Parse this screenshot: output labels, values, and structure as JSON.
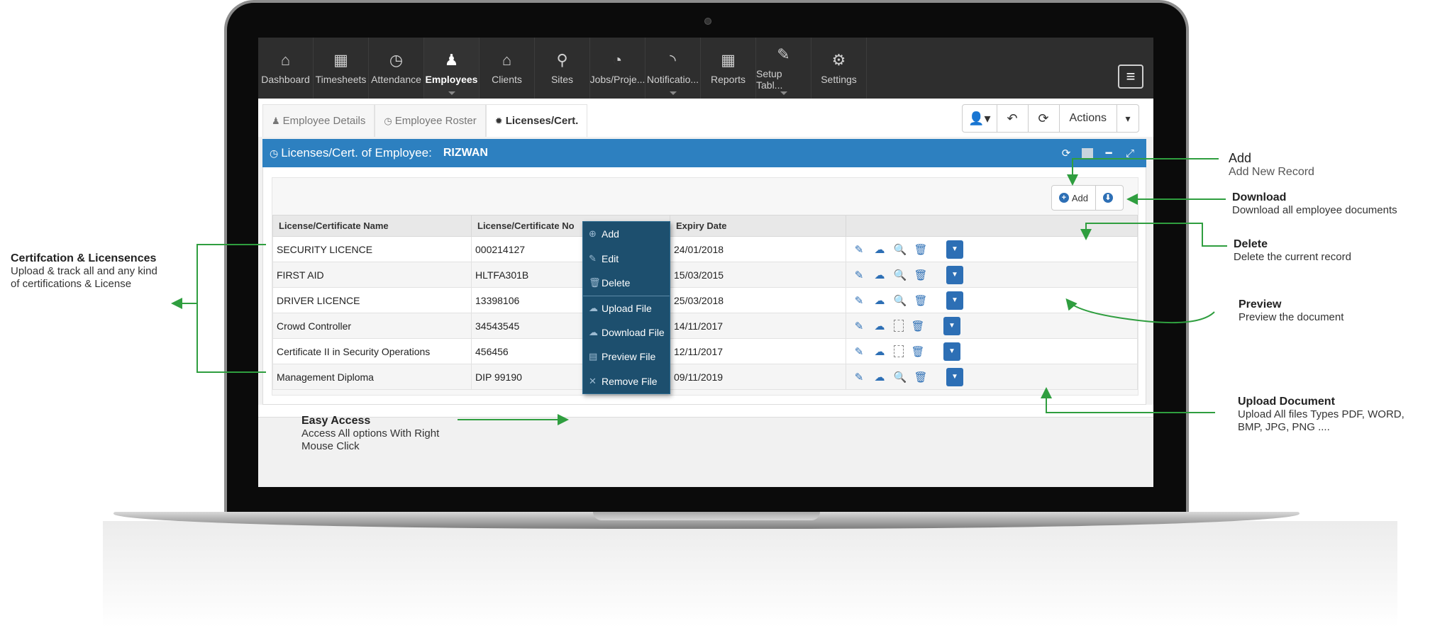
{
  "nav": {
    "items": [
      {
        "label": "Dashboard",
        "icon": "home-icon",
        "glyph": "⌂"
      },
      {
        "label": "Timesheets",
        "icon": "calendar-icon",
        "glyph": "▦"
      },
      {
        "label": "Attendance",
        "icon": "clock-icon",
        "glyph": "◷"
      },
      {
        "label": "Employees",
        "icon": "person-icon",
        "glyph": "♟"
      },
      {
        "label": "Clients",
        "icon": "bank-icon",
        "glyph": "⌂"
      },
      {
        "label": "Sites",
        "icon": "map-pin-icon",
        "glyph": "⚲"
      },
      {
        "label": "Jobs/Proje...",
        "icon": "dashboard-icon",
        "glyph": "◔"
      },
      {
        "label": "Notificatio...",
        "icon": "rss-icon",
        "glyph": "◝"
      },
      {
        "label": "Reports",
        "icon": "grid-icon",
        "glyph": "▦"
      },
      {
        "label": "Setup Tabl...",
        "icon": "edit-icon",
        "glyph": "✎"
      },
      {
        "label": "Settings",
        "icon": "gear-icon",
        "glyph": "⚙"
      }
    ],
    "menu_glyph": "≡"
  },
  "tabs": [
    {
      "label": "Employee Details",
      "glyph": "♟"
    },
    {
      "label": "Employee Roster",
      "glyph": "◷"
    },
    {
      "label": "Licenses/Cert.",
      "glyph": "✹"
    }
  ],
  "toolbar": {
    "user_glyph": "👤▾",
    "undo_glyph": "↶",
    "refresh_glyph": "⟳",
    "actions_label": "Actions",
    "caret_glyph": "▾"
  },
  "panel": {
    "title": "Licenses/Cert. of Employee:",
    "employee_name": "RIZWAN",
    "title_glyph": "◷",
    "tools": {
      "refresh": "⟳",
      "minimize": "━",
      "expand": "⤢"
    }
  },
  "add_button": {
    "label": "Add",
    "glyph": "+",
    "download_glyph": "⬇"
  },
  "table": {
    "headers": [
      "License/Certificate Name",
      "License/Certificate No",
      "Expiry Date",
      ""
    ],
    "rows": [
      {
        "name": "SECURITY LICENCE",
        "number": "000214127",
        "expiry": "24/01/2018",
        "has_file": true
      },
      {
        "name": "FIRST AID",
        "number": "HLTFA301B",
        "expiry": "15/03/2015",
        "has_file": true
      },
      {
        "name": "DRIVER LICENCE",
        "number": "13398106",
        "expiry": "25/03/2018",
        "has_file": true
      },
      {
        "name": "Crowd Controller",
        "number": "34543545",
        "expiry": "14/11/2017",
        "has_file": false
      },
      {
        "name": "Certificate II in Security Operations",
        "number": "456456",
        "expiry": "12/11/2017",
        "has_file": false
      },
      {
        "name": "Management Diploma",
        "number": "DIP 99190",
        "expiry": "09/11/2019",
        "has_file": true
      }
    ],
    "action_glyphs": {
      "edit": "✎",
      "upload": "☁",
      "preview": "🔍",
      "delete": "🗑",
      "dropdown": "▼"
    }
  },
  "context_menu": [
    {
      "label": "Add",
      "glyph": "⊕",
      "sep": false
    },
    {
      "label": "Edit",
      "glyph": "✎",
      "sep": false
    },
    {
      "label": "Delete",
      "glyph": "🗑",
      "sep": false
    },
    {
      "label": "Upload File",
      "glyph": "☁",
      "sep": true
    },
    {
      "label": "Download File",
      "glyph": "☁",
      "sep": false
    },
    {
      "label": "Preview File",
      "glyph": "▤",
      "sep": false
    },
    {
      "label": "Remove File",
      "glyph": "✕",
      "sep": false
    }
  ],
  "annotations": {
    "cert": {
      "title": "Certifcation & Licensences",
      "lines": [
        "Upload & track all and any kind",
        "of certifications & License"
      ]
    },
    "easy": {
      "title": "Easy Access",
      "lines": [
        "Access All options With Right",
        "Mouse Click"
      ]
    },
    "add": {
      "title": "Add",
      "lines": [
        "Add New Record"
      ]
    },
    "download": {
      "title": "Download",
      "lines": [
        "Download all employee documents"
      ]
    },
    "delete": {
      "title": "Delete",
      "lines": [
        "Delete the current record"
      ]
    },
    "preview": {
      "title": "Preview",
      "lines": [
        "Preview the document"
      ]
    },
    "upload": {
      "title": "Upload Document",
      "lines": [
        "Upload All files Types PDF, WORD,",
        "BMP, JPG, PNG ...."
      ]
    }
  },
  "colors": {
    "accent": "#2d80c0",
    "nav_bg": "#2e2e2e",
    "menu_bg": "#1d4f6e",
    "annotation_arrow": "#2f9e3f"
  }
}
